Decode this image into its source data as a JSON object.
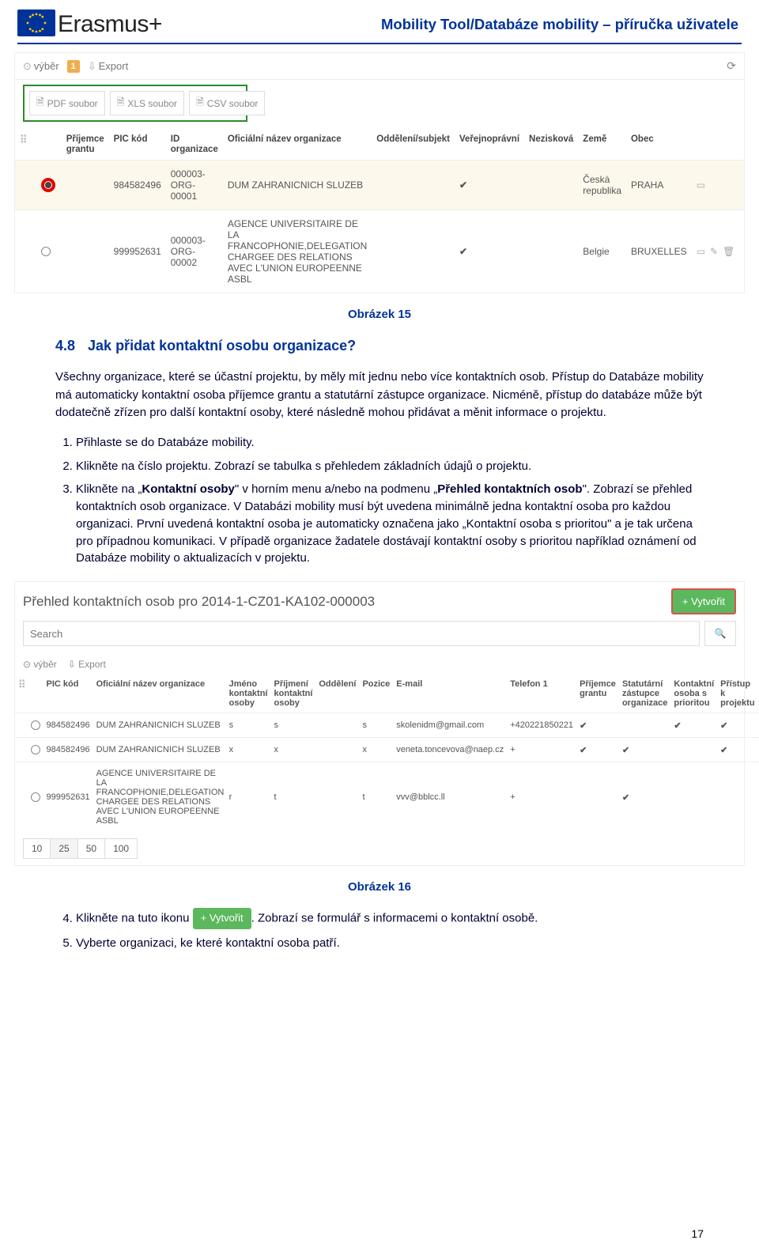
{
  "header": {
    "brand": "Erasmus",
    "brand_suffix": "+",
    "title": "Mobility Tool/Databáze mobility – příručka uživatele"
  },
  "shot1": {
    "bar_vyber": "výběr",
    "bar_badge": "1",
    "bar_export": "Export",
    "export": {
      "pdf": "PDF soubor",
      "xls": "XLS soubor",
      "csv": "CSV soubor"
    },
    "headers": {
      "h1": "Příjemce grantu",
      "h2": "PIC kód",
      "h3": "ID organizace",
      "h4": "Oficiální název organizace",
      "h5": "Oddělení/subjekt",
      "h6": "Veřejnoprávní",
      "h7": "Nezisková",
      "h8": "Země",
      "h9": "Obec"
    },
    "rows": [
      {
        "pic": "984582496",
        "orgid": "000003-ORG-00001",
        "name": "DUM ZAHRANICNICH SLUZEB",
        "dept": "",
        "public": "✔",
        "nonprofit": "",
        "country": "Česká republika",
        "city": "PRAHA",
        "selected": true
      },
      {
        "pic": "999952631",
        "orgid": "000003-ORG-00002",
        "name": "AGENCE UNIVERSITAIRE DE LA FRANCOPHONIE,DELEGATION CHARGEE DES RELATIONS AVEC L'UNION EUROPEENNE ASBL",
        "dept": "",
        "public": "✔",
        "nonprofit": "",
        "country": "Belgie",
        "city": "BRUXELLES",
        "selected": false
      }
    ]
  },
  "caption1": "Obrázek 15",
  "section": {
    "num": "4.8",
    "title": "Jak přidat kontaktní osobu organizace?",
    "intro": "Všechny organizace, které se účastní projektu, by měly mít jednu nebo více kontaktních osob. Přístup do Databáze mobility má automaticky kontaktní osoba příjemce grantu a statutární zástupce organizace. Nicméně, přístup do databáze může být dodatečně zřízen pro další kontaktní osoby, které následně mohou přidávat a měnit informace o projektu.",
    "step1": "Přihlaste se do Databáze mobility.",
    "step2": "Klikněte na číslo projektu. Zobrazí se tabulka s přehledem základních údajů o projektu.",
    "step3_a": "Klikněte na „",
    "step3_b": "Kontaktní osoby",
    "step3_c": "\" v horním menu a/nebo na podmenu „",
    "step3_d": "Přehled kontaktních osob",
    "step3_e": "\". Zobrazí se přehled kontaktních osob organizace. V Databázi mobility musí být uvedena minimálně jedna kontaktní osoba pro každou organizaci. První uvedená kontaktní osoba je automaticky označena jako „Kontaktní osoba s prioritou\" a je tak určena pro případnou komunikaci. V případě organizace žadatele dostávají kontaktní osoby s prioritou například oznámení od Databáze mobility o aktualizacích v projektu."
  },
  "shot2": {
    "title": "Přehled kontaktních osob pro 2014-1-CZ01-KA102-000003",
    "create_btn": "+ Vytvořit",
    "search_placeholder": "Search",
    "bar_vyber": "výběr",
    "bar_export": "Export",
    "headers": {
      "h1": "PIC kód",
      "h2": "Oficiální název organizace",
      "h3": "Jméno kontaktní osoby",
      "h4": "Příjmení kontaktní osoby",
      "h5": "Oddělení",
      "h6": "Pozice",
      "h7": "E-mail",
      "h8": "Telefon 1",
      "h9": "Příjemce grantu",
      "h10": "Statutární zástupce organizace",
      "h11": "Kontaktní osoba s prioritou",
      "h12": "Přístup k projektu"
    },
    "rows": [
      {
        "pic": "984582496",
        "org": "DUM ZAHRANICNICH SLUZEB",
        "fn": "s",
        "ln": "s",
        "dept": "",
        "pos": "s",
        "email": "skolenidm@gmail.com",
        "tel": "+420221850221",
        "pg": "✔",
        "sz": "",
        "pr": "✔",
        "ap": "✔"
      },
      {
        "pic": "984582496",
        "org": "DUM ZAHRANICNICH SLUZEB",
        "fn": "x",
        "ln": "x",
        "dept": "",
        "pos": "x",
        "email": "veneta.toncevova@naep.cz",
        "tel": "+",
        "pg": "✔",
        "sz": "✔",
        "pr": "",
        "ap": "✔"
      },
      {
        "pic": "999952631",
        "org": "AGENCE UNIVERSITAIRE DE LA FRANCOPHONIE,DELEGATION CHARGEE DES RELATIONS AVEC L'UNION EUROPEENNE ASBL",
        "fn": "r",
        "ln": "t",
        "dept": "",
        "pos": "t",
        "email": "vvv@bblcc.ll",
        "tel": "+",
        "pg": "",
        "sz": "✔",
        "pr": "",
        "ap": ""
      }
    ],
    "pager": [
      "10",
      "25",
      "50",
      "100"
    ]
  },
  "caption2": "Obrázek 16",
  "final": {
    "s4_a": "Klikněte na tuto ikonu ",
    "s4_btn": "+ Vytvořit",
    "s4_b": ". Zobrazí se formulář s informacemi o kontaktní osobě.",
    "s5": "Vyberte organizaci, ke které kontaktní osoba patří."
  },
  "page_num": "17"
}
